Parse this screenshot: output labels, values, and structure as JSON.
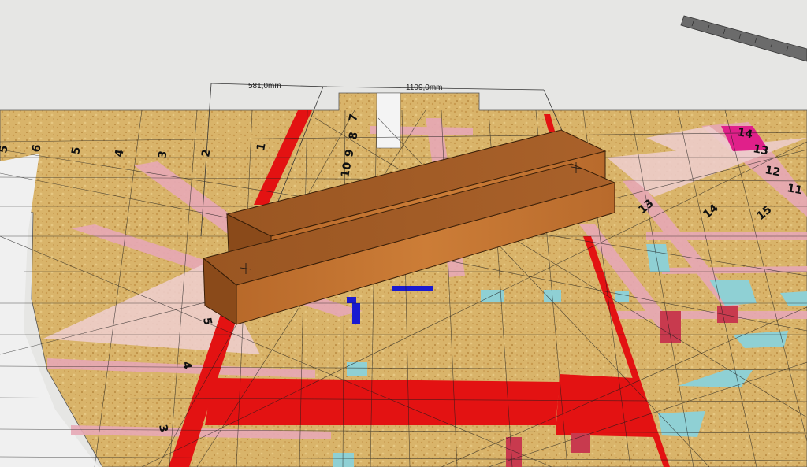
{
  "dimensions": {
    "left_label": "581,0mm",
    "right_label": "1109,0mm"
  },
  "board_numbers": {
    "top_left_row": [
      "5",
      "6",
      "5",
      "4",
      "3",
      "2",
      "1"
    ],
    "vertical_column": [
      "7",
      "8",
      "9",
      "10"
    ],
    "right_side": [
      "14",
      "13",
      "12",
      "11",
      "13",
      "14",
      "15"
    ],
    "left_lower": [
      "5",
      "4",
      "3"
    ]
  },
  "colors": {
    "background": "#e6e6e4",
    "board": "#d9b46a",
    "red_strip": "#e31212",
    "pink_strip": "#e7a8b6",
    "light_pink": "#efcfd0",
    "cyan_patch": "#8fd0d4",
    "magenta": "#e0208a",
    "blue": "#1a1ad0",
    "wood_top": "#a65f26",
    "wood_side": "#c47531",
    "wood_end": "#8a4a1a",
    "ruler": "#6b6b6b"
  }
}
